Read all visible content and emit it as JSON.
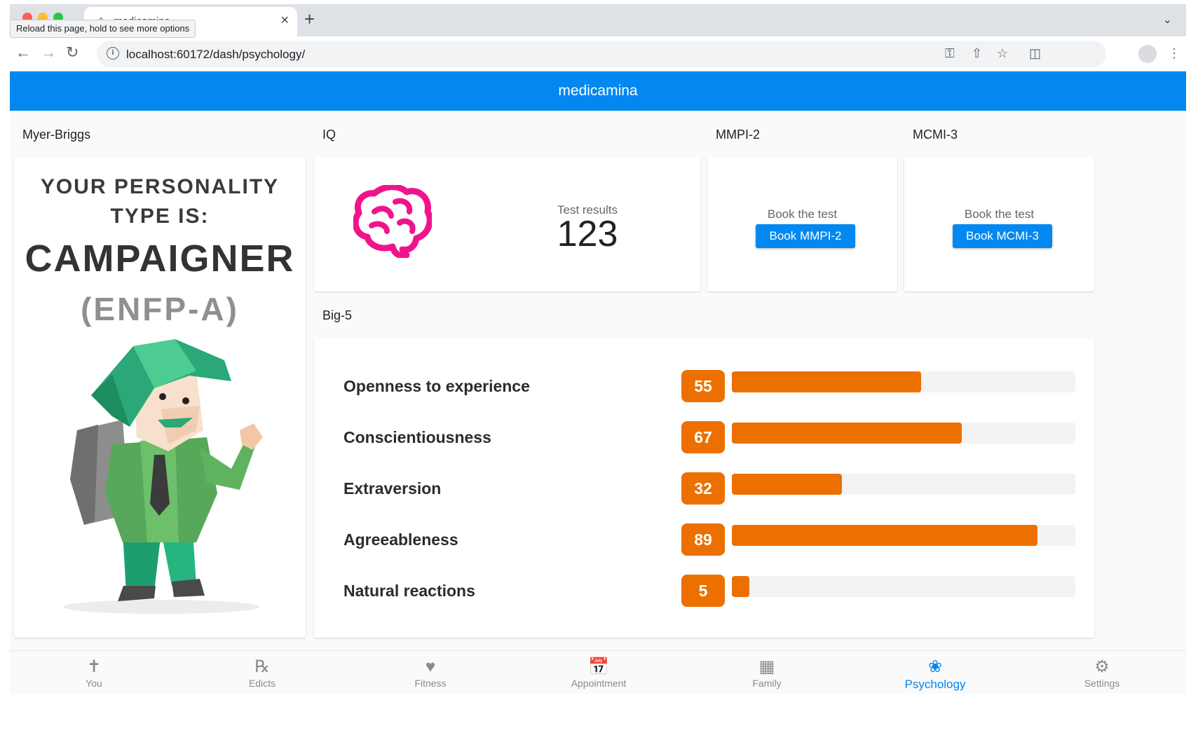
{
  "browser": {
    "tab_title": "medicamina",
    "tooltip": "Reload this page, hold to see more options",
    "url": "localhost:60172/dash/psychology/"
  },
  "app": {
    "title": "medicamina",
    "accent_color": "#0288f0"
  },
  "sections": {
    "myer_briggs": "Myer-Briggs",
    "iq": "IQ",
    "mmpi2": "MMPI-2",
    "mcmi3": "MCMI-3",
    "big5": "Big-5"
  },
  "myer_briggs": {
    "heading": "YOUR PERSONALITY TYPE IS:",
    "type": "CAMPAIGNER",
    "code": "(ENFP-A)"
  },
  "iq": {
    "caption": "Test results",
    "value": "123",
    "icon": "brain-icon"
  },
  "mmpi2": {
    "caption": "Book the test",
    "button": "Book MMPI-2"
  },
  "mcmi3": {
    "caption": "Book the test",
    "button": "Book MCMI-3"
  },
  "big5": {
    "bar_color": "#ec7000",
    "traits": [
      {
        "name": "Openness to experience",
        "value": 55
      },
      {
        "name": "Conscientiousness",
        "value": 67
      },
      {
        "name": "Extraversion",
        "value": 32
      },
      {
        "name": "Agreeableness",
        "value": 89
      },
      {
        "name": "Natural reactions",
        "value": 5
      }
    ]
  },
  "bottom_nav": [
    {
      "label": "You",
      "icon": "person-icon",
      "active": false
    },
    {
      "label": "Edicts",
      "icon": "prescription-icon",
      "active": false
    },
    {
      "label": "Fitness",
      "icon": "heart-pulse-icon",
      "active": false
    },
    {
      "label": "Appointment",
      "icon": "calendar-clock-icon",
      "active": false
    },
    {
      "label": "Family",
      "icon": "family-tree-icon",
      "active": false
    },
    {
      "label": "Psychology",
      "icon": "brain-icon",
      "active": true
    },
    {
      "label": "Settings",
      "icon": "gear-icon",
      "active": false
    }
  ]
}
